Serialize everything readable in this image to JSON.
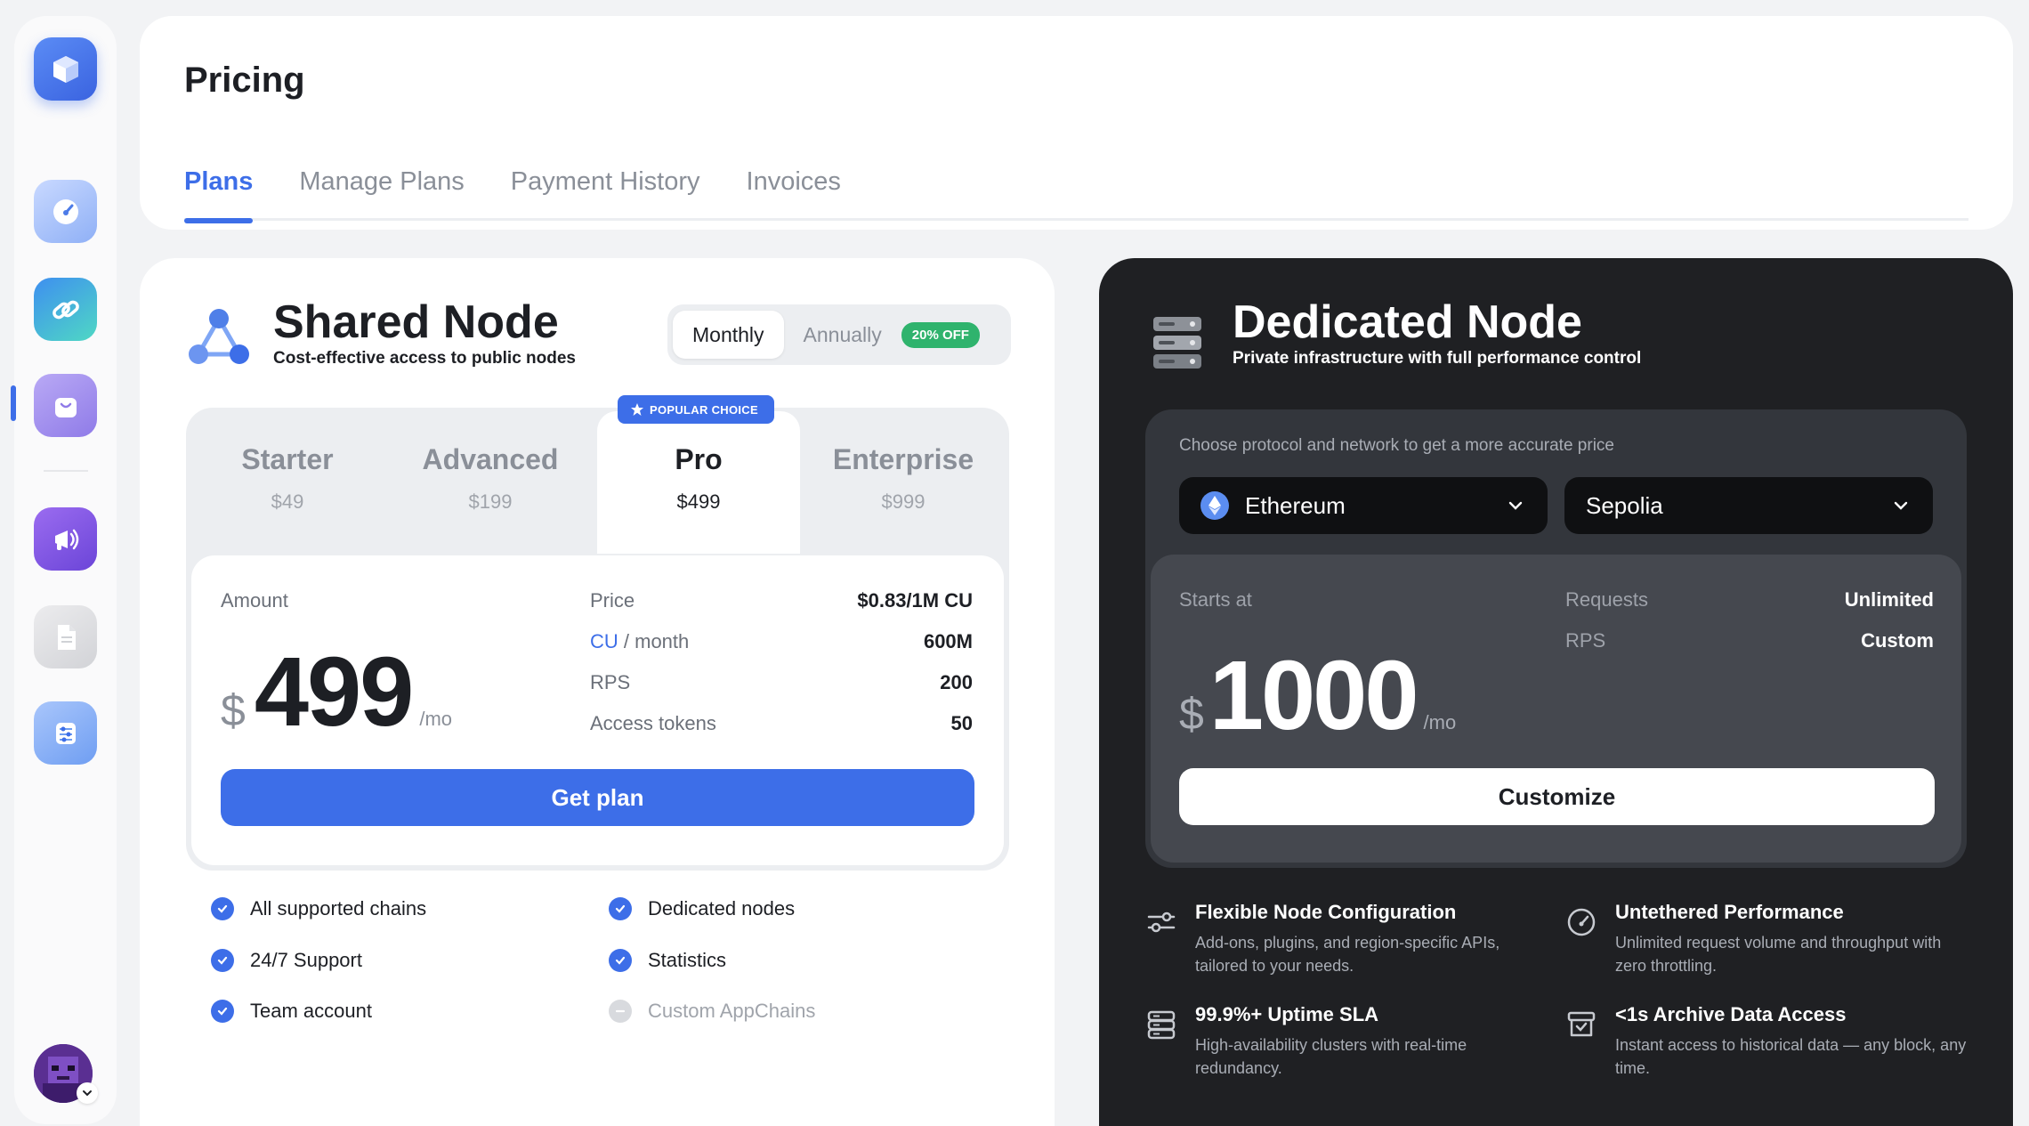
{
  "header": {
    "title": "Pricing",
    "tabs": [
      {
        "label": "Plans"
      },
      {
        "label": "Manage Plans"
      },
      {
        "label": "Payment History"
      },
      {
        "label": "Invoices"
      }
    ]
  },
  "sidebar": {
    "items": [
      {
        "icon": "cube-icon"
      },
      {
        "icon": "gauge-icon"
      },
      {
        "icon": "link-icon"
      },
      {
        "icon": "bag-icon"
      },
      {
        "icon": "megaphone-icon"
      },
      {
        "icon": "document-icon"
      },
      {
        "icon": "sliders-icon"
      }
    ],
    "active_index": 3
  },
  "shared": {
    "title": "Shared Node",
    "subtitle": "Cost-effective access to public nodes",
    "billing": {
      "monthly": "Monthly",
      "annually": "Annually",
      "discount": "20% OFF",
      "selected": "Monthly"
    },
    "popular_label": "POPULAR CHOICE",
    "plans": [
      {
        "name": "Starter",
        "price": "$49"
      },
      {
        "name": "Advanced",
        "price": "$199"
      },
      {
        "name": "Pro",
        "price": "$499"
      },
      {
        "name": "Enterprise",
        "price": "$999"
      }
    ],
    "selected_plan": "Pro",
    "amount_label": "Amount",
    "currency": "$",
    "amount": "499",
    "period": "/mo",
    "specs": {
      "price_label": "Price",
      "price_value": "$0.83/1M CU",
      "cu_label_hl": "CU",
      "cu_label_rest": " / month",
      "cu_value": "600M",
      "rps_label": "RPS",
      "rps_value": "200",
      "tokens_label": "Access tokens",
      "tokens_value": "50"
    },
    "cta": "Get plan",
    "features": [
      {
        "label": "All supported chains",
        "enabled": true
      },
      {
        "label": "24/7 Support",
        "enabled": true
      },
      {
        "label": "Team account",
        "enabled": true
      },
      {
        "label": "Dedicated nodes",
        "enabled": true
      },
      {
        "label": "Statistics",
        "enabled": true
      },
      {
        "label": "Custom AppChains",
        "enabled": false
      }
    ]
  },
  "dedicated": {
    "title": "Dedicated Node",
    "subtitle": "Private infrastructure with full performance control",
    "hint": "Choose protocol and network to get a more accurate price",
    "protocol": "Ethereum",
    "network": "Sepolia",
    "starts_label": "Starts at",
    "currency": "$",
    "amount": "1000",
    "period": "/mo",
    "specs": {
      "requests_label": "Requests",
      "requests_value": "Unlimited",
      "rps_label": "RPS",
      "rps_value": "Custom"
    },
    "cta": "Customize",
    "benefits": [
      {
        "title": "Flexible Node Configuration",
        "desc": "Add-ons, plugins, and region-specific APIs, tailored to your needs.",
        "icon": "sliders-icon"
      },
      {
        "title": "Untethered Performance",
        "desc": "Unlimited request volume and throughput with zero throttling.",
        "icon": "speedometer-icon"
      },
      {
        "title": "99.9%+ Uptime SLA",
        "desc": "High-availability clusters with real-time redundancy.",
        "icon": "server-icon"
      },
      {
        "title": "<1s Archive Data Access",
        "desc": "Instant access to historical data — any block, any time.",
        "icon": "archive-icon"
      }
    ]
  },
  "colors": {
    "accent": "#3d6ee8",
    "success": "#2fb36d",
    "dark_card": "#1f2023"
  }
}
